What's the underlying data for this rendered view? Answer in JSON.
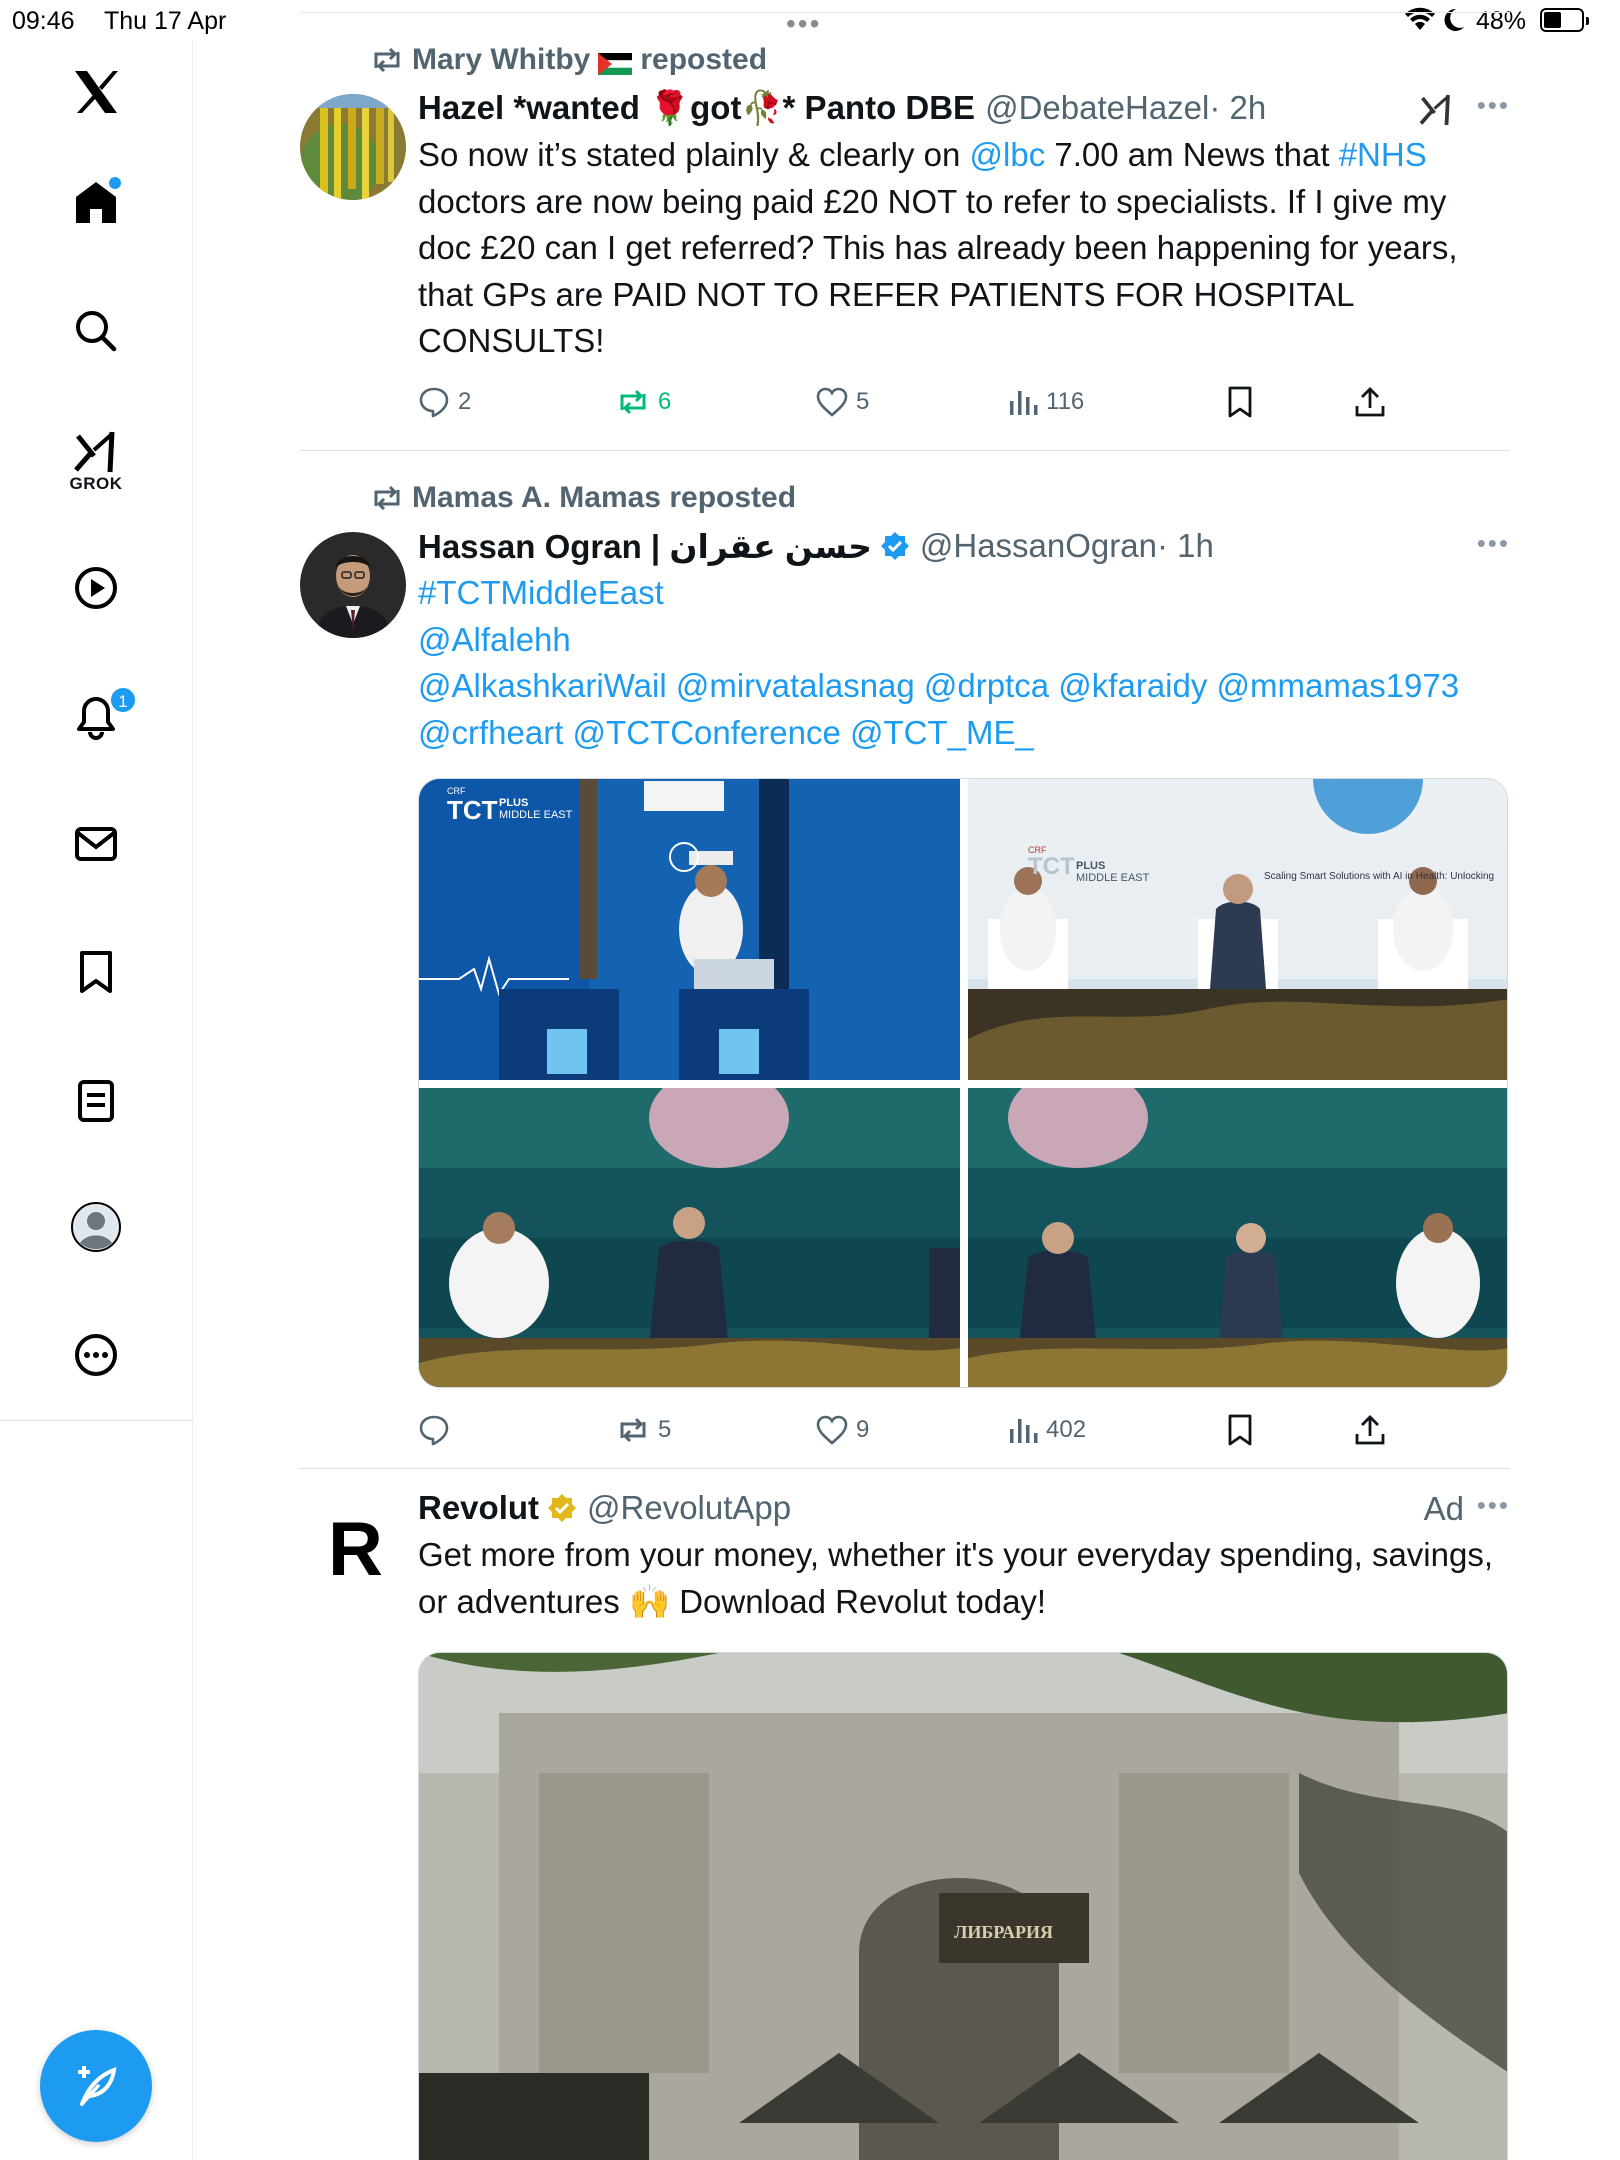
{
  "status_bar": {
    "time": "09:46",
    "date": "Thu 17 Apr",
    "battery_text": "48%",
    "battery_level": 0.48,
    "center_dots": "•••"
  },
  "sidebar": {
    "items": [
      {
        "name": "x-logo-icon"
      },
      {
        "name": "home-icon",
        "has_dot": true
      },
      {
        "name": "search-icon"
      },
      {
        "name": "grok-icon",
        "label": "GROK"
      },
      {
        "name": "play-icon"
      },
      {
        "name": "notifications-icon",
        "badge": "1"
      },
      {
        "name": "mail-icon"
      },
      {
        "name": "bookmark-icon"
      },
      {
        "name": "lists-icon"
      },
      {
        "name": "profile-icon"
      },
      {
        "name": "more-circle-icon"
      }
    ],
    "accent": "#1d9bf0"
  },
  "tweets": [
    {
      "repost_label": "Mary Whitby",
      "repost_suffix": "reposted",
      "display_name": "Hazel *wanted 🌹got🥀* Panto DBE",
      "handle": "@DebateHazel",
      "time": "· 2h",
      "text_parts": [
        {
          "t": "So now it’s stated plainly & clearly on ",
          "link": false
        },
        {
          "t": "@lbc",
          "link": true
        },
        {
          "t": " 7.00 am News that ",
          "link": false
        },
        {
          "t": "#NHS",
          "link": true
        },
        {
          "t": " doctors are now being paid £20 NOT to refer to specialists.  If I give my doc £20 can I get referred? This has already been happening for years, that GPs are PAID NOT TO REFER PATIENTS FOR HOSPITAL CONSULTS!",
          "link": false
        }
      ],
      "replies": "2",
      "reposts": "6",
      "likes": "5",
      "views": "116"
    },
    {
      "repost_label": "Mamas A. Mamas reposted",
      "display_name": "Hassan Ogran | حسن عقران",
      "handle": "@HassanOgran",
      "time": "· 1h",
      "lines": [
        "#TCTMiddleEast",
        "@Alfalehh",
        "@AlkashkariWail @mirvatalasnag @drptca @kfaraidy @mmamas1973",
        "@crfheart @TCTConference  @TCT_ME_"
      ],
      "replies": "",
      "reposts": "5",
      "likes": "9",
      "views": "402",
      "media_texts": {
        "tct_logo": "TCT",
        "plus": "PLUS",
        "middle_east": "MIDDLE EAST",
        "crf": "CRF",
        "banner": "Scaling Smart Solutions with AI in Health: Unlocking"
      }
    },
    {
      "display_name": "Revolut",
      "handle": "@RevolutApp",
      "ad_label": "Ad",
      "text": "Get more from your money, whether it's your everyday spending, savings, or adventures 🙌 Download Revolut today!",
      "logo_letter": "R",
      "sign_text": "ЛИБРАРИЯ"
    }
  ]
}
